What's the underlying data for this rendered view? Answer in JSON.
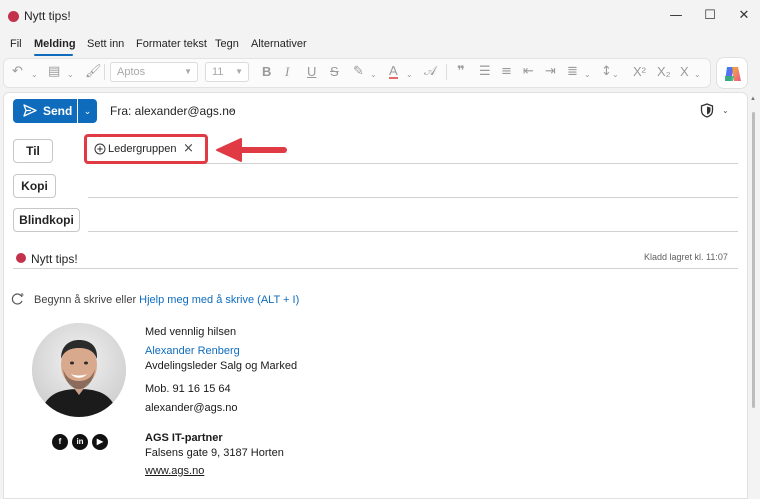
{
  "window": {
    "title": "Nytt tips!",
    "minimize": "—",
    "maximize": "☐",
    "close": "✕"
  },
  "menu": [
    "Fil",
    "Melding",
    "Sett inn",
    "Formater tekst",
    "Tegn",
    "Alternativer"
  ],
  "ribbon": {
    "font_name": "Aptos",
    "font_size": "11"
  },
  "compose": {
    "send_label": "Send",
    "from_label": "Fra: alexander@ags.no",
    "to_label": "Til",
    "cc_label": "Kopi",
    "bcc_label": "Blindkopi",
    "recipient_chip": "Ledergruppen",
    "subject": "Nytt tips!",
    "saved_status": "Kladd lagret kl. 11:07",
    "prompt_text": "Begynn å skrive eller ",
    "prompt_link": "Hjelp meg med å skrive (ALT + I)"
  },
  "signature": {
    "greeting": "Med vennlig hilsen",
    "name": "Alexander Renberg",
    "role": "Avdelingsleder Salg og Marked",
    "mobile": "Mob.  91 16 15 64",
    "email": "alexander@ags.no",
    "company": "AGS IT-partner",
    "address": "Falsens gate 9, 3187 Horten",
    "website": "www.ags.no",
    "social_icons": [
      "facebook-icon",
      "linkedin-icon",
      "youtube-icon"
    ]
  },
  "colors": {
    "accent": "#0f6cbd",
    "highlight_red": "#e03b44",
    "status_dot": "#c4314b"
  }
}
